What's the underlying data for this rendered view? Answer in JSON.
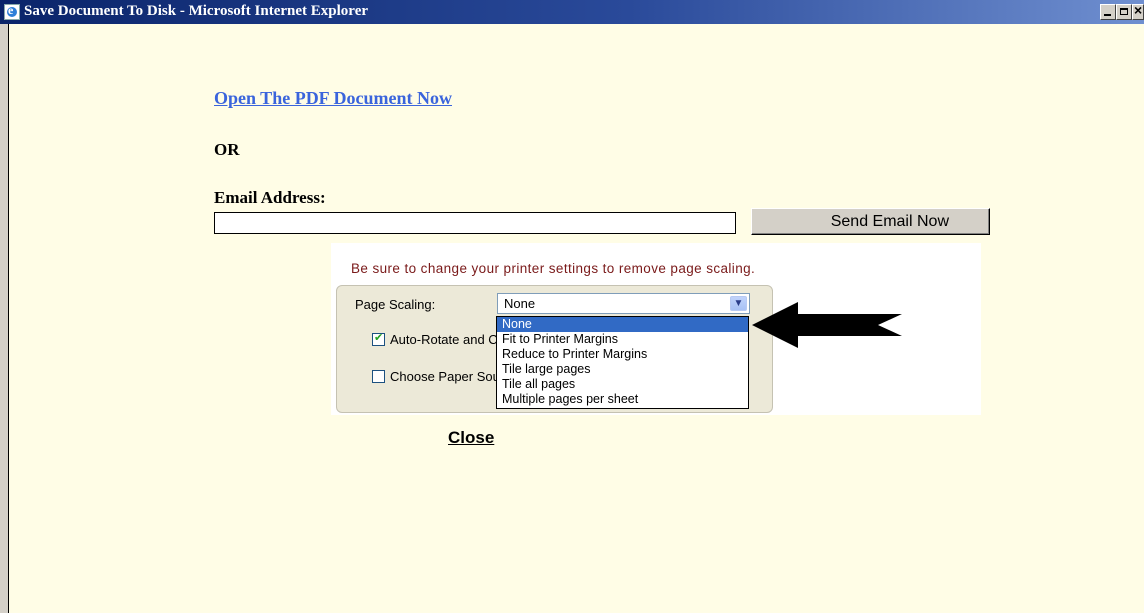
{
  "window": {
    "title": "Save Document To Disk - Microsoft Internet Explorer",
    "icon": "ie-icon",
    "controls": [
      "minimize-icon",
      "maximize-icon",
      "close-icon"
    ]
  },
  "main": {
    "pdf_link": "Open The PDF Document Now",
    "or_label": "OR",
    "email_label": "Email Address:",
    "email_value": "",
    "send_button": "Send Email Now",
    "close_link": "Close"
  },
  "print_settings": {
    "notice": "Be sure to change your printer settings to remove page scaling.",
    "page_scaling_label": "Page Scaling:",
    "page_scaling_value": "None",
    "auto_rotate_label": "Auto-Rotate and Center",
    "auto_rotate_checked": true,
    "choose_paper_label": "Choose Paper Source by PDF page size",
    "choose_paper_checked": false,
    "options": [
      "None",
      "Fit to Printer Margins",
      "Reduce to Printer Margins",
      "Tile large pages",
      "Tile all pages",
      "Multiple pages per sheet"
    ],
    "selected_option": 0
  },
  "colors": {
    "page_background": "#fffde6",
    "link": "#3a64dc",
    "titlebar": "#0a246a",
    "selection": "#316ac5",
    "notice_text": "#7a1a1a"
  }
}
